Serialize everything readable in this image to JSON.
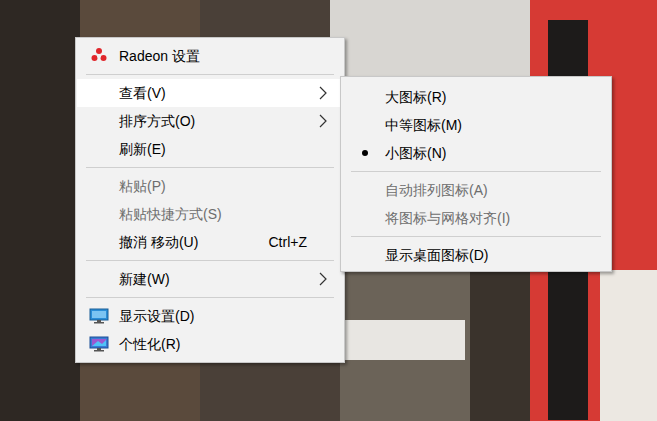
{
  "menu": {
    "items": [
      {
        "kind": "item",
        "label": "Radeon 设置",
        "selected": false,
        "disabled": false,
        "has_submenu": false
      },
      {
        "kind": "separator"
      },
      {
        "kind": "item",
        "label": "查看(V)",
        "selected": true,
        "disabled": false,
        "has_submenu": true
      },
      {
        "kind": "item",
        "label": "排序方式(O)",
        "selected": false,
        "disabled": false,
        "has_submenu": true
      },
      {
        "kind": "item",
        "label": "刷新(E)",
        "selected": false,
        "disabled": false,
        "has_submenu": false
      },
      {
        "kind": "separator"
      },
      {
        "kind": "item",
        "label": "粘贴(P)",
        "selected": false,
        "disabled": true,
        "has_submenu": false
      },
      {
        "kind": "item",
        "label": "粘贴快捷方式(S)",
        "selected": false,
        "disabled": true,
        "has_submenu": false
      },
      {
        "kind": "item",
        "label": "撤消 移动(U)",
        "shortcut": "Ctrl+Z",
        "selected": false,
        "disabled": false,
        "has_submenu": false
      },
      {
        "kind": "separator"
      },
      {
        "kind": "item",
        "label": "新建(W)",
        "selected": false,
        "disabled": false,
        "has_submenu": true
      },
      {
        "kind": "separator"
      },
      {
        "kind": "item",
        "label": "显示设置(D)",
        "selected": false,
        "disabled": false,
        "has_submenu": false
      },
      {
        "kind": "item",
        "label": "个性化(R)",
        "selected": false,
        "disabled": false,
        "has_submenu": false
      }
    ]
  },
  "submenu": {
    "items": [
      {
        "kind": "item",
        "label": "大图标(R)",
        "checked": false,
        "disabled": false
      },
      {
        "kind": "item",
        "label": "中等图标(M)",
        "checked": false,
        "disabled": false
      },
      {
        "kind": "item",
        "label": "小图标(N)",
        "checked": true,
        "disabled": false
      },
      {
        "kind": "separator"
      },
      {
        "kind": "item",
        "label": "自动排列图标(A)",
        "checked": false,
        "disabled": true
      },
      {
        "kind": "item",
        "label": "将图标与网格对齐(I)",
        "checked": false,
        "disabled": true
      },
      {
        "kind": "separator"
      },
      {
        "kind": "item",
        "label": "显示桌面图标(D)",
        "checked": false,
        "disabled": false
      }
    ]
  }
}
